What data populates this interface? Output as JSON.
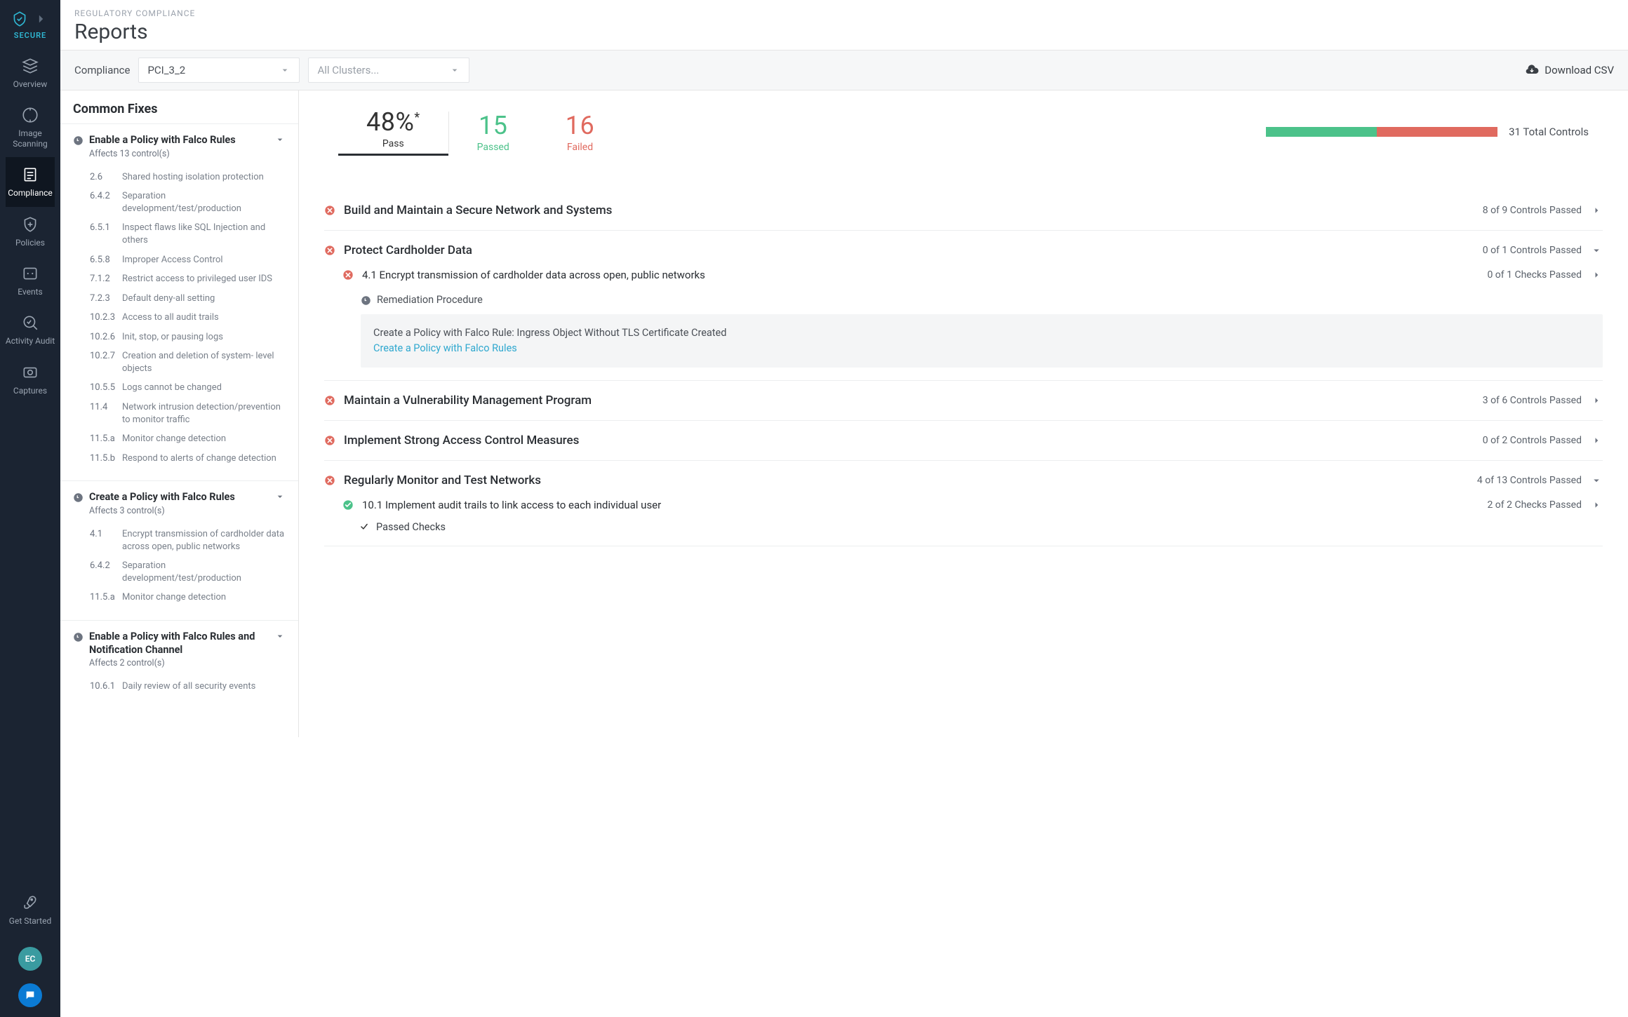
{
  "brand": "SECURE",
  "nav": [
    {
      "id": "overview",
      "label": "Overview"
    },
    {
      "id": "image-scanning",
      "label": "Image\nScanning"
    },
    {
      "id": "compliance",
      "label": "Compliance",
      "active": true
    },
    {
      "id": "policies",
      "label": "Policies"
    },
    {
      "id": "events",
      "label": "Events"
    },
    {
      "id": "activity-audit",
      "label": "Activity Audit"
    },
    {
      "id": "captures",
      "label": "Captures"
    }
  ],
  "get_started": "Get Started",
  "avatar": "EC",
  "header": {
    "eyebrow": "REGULATORY COMPLIANCE",
    "title": "Reports"
  },
  "filters": {
    "label": "Compliance",
    "compliance_value": "PCI_3_2",
    "clusters_placeholder": "All Clusters...",
    "download": "Download CSV"
  },
  "fixes_title": "Common Fixes",
  "fix_groups": [
    {
      "title": "Enable a Policy with Falco Rules",
      "affects": "Affects 13 control(s)",
      "children": [
        {
          "num": "2.6",
          "txt": "Shared hosting isolation protection"
        },
        {
          "num": "6.4.2",
          "txt": "Separation development/test/production"
        },
        {
          "num": "6.5.1",
          "txt": "Inspect flaws like SQL Injection and others"
        },
        {
          "num": "6.5.8",
          "txt": "Improper Access Control"
        },
        {
          "num": "7.1.2",
          "txt": "Restrict access to privileged user IDS"
        },
        {
          "num": "7.2.3",
          "txt": "Default deny-all setting"
        },
        {
          "num": "10.2.3",
          "txt": "Access to all audit trails"
        },
        {
          "num": "10.2.6",
          "txt": "Init, stop, or pausing logs"
        },
        {
          "num": "10.2.7",
          "txt": "Creation and deletion of system- level objects"
        },
        {
          "num": "10.5.5",
          "txt": "Logs cannot be changed"
        },
        {
          "num": "11.4",
          "txt": "Network intrusion detection/prevention to monitor traffic"
        },
        {
          "num": "11.5.a",
          "txt": "Monitor change detection"
        },
        {
          "num": "11.5.b",
          "txt": "Respond to alerts of change detection"
        }
      ]
    },
    {
      "title": "Create a Policy with Falco Rules",
      "affects": "Affects 3 control(s)",
      "children": [
        {
          "num": "4.1",
          "txt": "Encrypt transmission of cardholder data across open, public networks"
        },
        {
          "num": "6.4.2",
          "txt": "Separation development/test/production"
        },
        {
          "num": "11.5.a",
          "txt": "Monitor change detection"
        }
      ]
    },
    {
      "title": "Enable a Policy with Falco Rules and Notification Channel",
      "affects": "Affects 2 control(s)",
      "children": [
        {
          "num": "10.6.1",
          "txt": "Daily review of all security events"
        }
      ]
    }
  ],
  "stats": {
    "pass_pct": "48%",
    "pass_label": "Pass",
    "passed_count": "15",
    "passed_label": "Passed",
    "failed_count": "16",
    "failed_label": "Failed",
    "total_label": "31 Total Controls",
    "bar_pass_pct": 48
  },
  "sections": [
    {
      "status": "fail",
      "title": "Build and Maintain a Secure Network and Systems",
      "count": "8 of 9 Controls Passed",
      "chev": "right"
    },
    {
      "status": "fail",
      "title": "Protect Cardholder Data",
      "count": "0 of 1 Controls Passed",
      "chev": "down",
      "sub": {
        "status": "fail",
        "title": "4.1 Encrypt transmission of cardholder data across open, public networks",
        "count": "0 of 1 Checks Passed",
        "remediation": {
          "heading": "Remediation Procedure",
          "body": "Create a Policy with Falco Rule: Ingress Object Without TLS Certificate Created",
          "link": "Create a Policy with Falco Rules"
        }
      }
    },
    {
      "status": "fail",
      "title": "Maintain a Vulnerability Management Program",
      "count": "3 of 6 Controls Passed",
      "chev": "right"
    },
    {
      "status": "fail",
      "title": "Implement Strong Access Control Measures",
      "count": "0 of 2 Controls Passed",
      "chev": "right"
    },
    {
      "status": "fail",
      "title": "Regularly Monitor and Test Networks",
      "count": "4 of 13 Controls Passed",
      "chev": "down",
      "sub": {
        "status": "pass",
        "title": "10.1 Implement audit trails to link access to each individual user",
        "count": "2 of 2 Checks Passed",
        "passed_checks": "Passed Checks"
      }
    }
  ]
}
